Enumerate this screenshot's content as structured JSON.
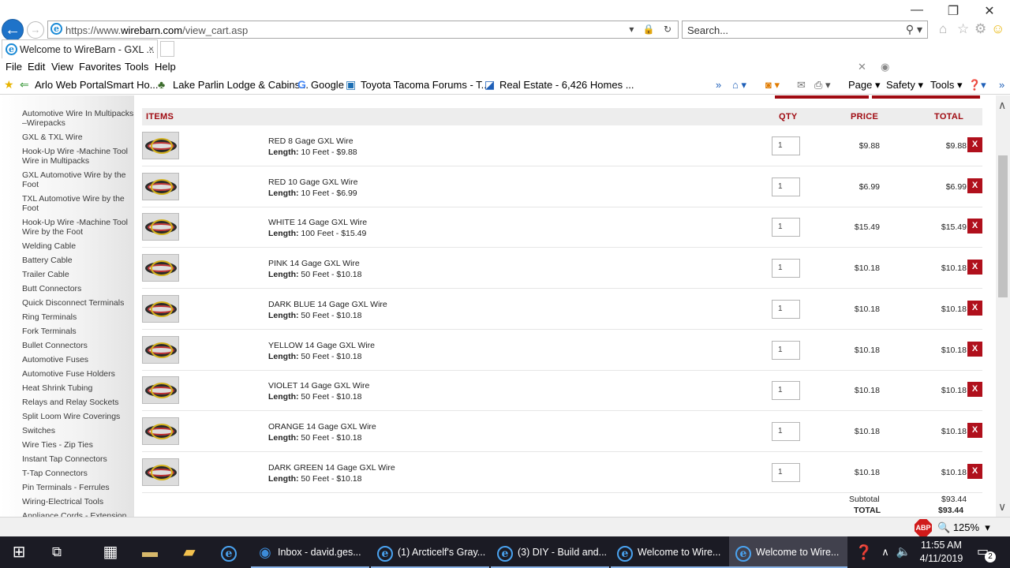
{
  "browser": {
    "url_prefix": "https://www.",
    "url_domain": "wirebarn.com",
    "url_path": "/view_cart.asp",
    "search_placeholder": "Search...",
    "tab_title": "Welcome to WireBarn - GXL ...",
    "tab_close": "×"
  },
  "menu": [
    "File",
    "Edit",
    "View",
    "Favorites",
    "Tools",
    "Help"
  ],
  "favorites": [
    "Arlo Web PortalSmart Ho...",
    "Lake Parlin Lodge & Cabins...",
    "Google",
    "Toyota Tacoma Forums - T...",
    "Real Estate - 6,426 Homes ..."
  ],
  "commands": {
    "page": "Page",
    "safety": "Safety",
    "tools": "Tools"
  },
  "sidebar": [
    "Automotive Wire In Multipacks –Wirepacks",
    "GXL & TXL Wire",
    "Hook-Up Wire -Machine Tool Wire in Multipacks",
    "GXL Automotive Wire by the Foot",
    "TXL Automotive Wire by the Foot",
    "Hook-Up Wire -Machine Tool Wire by the Foot",
    "Welding Cable",
    "Battery Cable",
    "Trailer Cable",
    "Butt Connectors",
    "Quick Disconnect Terminals",
    "Ring Terminals",
    "Fork Terminals",
    "Bullet Connectors",
    "Automotive Fuses",
    "Automotive Fuse Holders",
    "Heat Shrink Tubing",
    "Relays and Relay Sockets",
    "Split Loom Wire Coverings",
    "Switches",
    "Wire Ties - Zip Ties",
    "Instant Tap Connectors",
    "T-Tap Connectors",
    "Pin Terminals - Ferrules",
    "Wiring-Electrical Tools",
    "Appliance Cords - Extension"
  ],
  "cart": {
    "headers": {
      "items": "ITEMS",
      "qty": "QTY",
      "price": "PRICE",
      "total": "TOTAL"
    },
    "length_label": "Length:",
    "remove_label": "X",
    "items": [
      {
        "name": "RED 8 Gage GXL Wire",
        "length": "10 Feet - $9.88",
        "qty": "1",
        "price": "$9.88",
        "total": "$9.88"
      },
      {
        "name": "RED 10 Gage GXL Wire",
        "length": "10 Feet - $6.99",
        "qty": "1",
        "price": "$6.99",
        "total": "$6.99"
      },
      {
        "name": "WHITE 14 Gage GXL Wire",
        "length": "100 Feet - $15.49",
        "qty": "1",
        "price": "$15.49",
        "total": "$15.49"
      },
      {
        "name": "PINK 14 Gage GXL Wire",
        "length": "50 Feet - $10.18",
        "qty": "1",
        "price": "$10.18",
        "total": "$10.18"
      },
      {
        "name": "DARK BLUE 14 Gage GXL Wire",
        "length": "50 Feet - $10.18",
        "qty": "1",
        "price": "$10.18",
        "total": "$10.18"
      },
      {
        "name": "YELLOW 14 Gage GXL Wire",
        "length": "50 Feet - $10.18",
        "qty": "1",
        "price": "$10.18",
        "total": "$10.18"
      },
      {
        "name": "VIOLET 14 Gage GXL Wire",
        "length": "50 Feet - $10.18",
        "qty": "1",
        "price": "$10.18",
        "total": "$10.18"
      },
      {
        "name": "ORANGE 14 Gage GXL Wire",
        "length": "50 Feet - $10.18",
        "qty": "1",
        "price": "$10.18",
        "total": "$10.18"
      },
      {
        "name": "DARK GREEN 14 Gage GXL Wire",
        "length": "50 Feet - $10.18",
        "qty": "1",
        "price": "$10.18",
        "total": "$10.18"
      }
    ],
    "subtotal_label": "Subtotal",
    "subtotal": "$93.44",
    "total_label": "TOTAL",
    "total": "$93.44"
  },
  "status": {
    "abp": "ABP",
    "zoom": "125%"
  },
  "taskbar": {
    "apps": [
      "Inbox - david.ges...",
      "(1) Arcticelf's Gray...",
      "(3) DIY - Build and...",
      "Welcome to Wire...",
      "Welcome to Wire..."
    ],
    "time": "11:55 AM",
    "date": "4/11/2019",
    "notifications": "2"
  },
  "colors": {
    "accent": "#a00b12",
    "remove": "#b0101c",
    "ie_blue": "#1e73c9"
  }
}
